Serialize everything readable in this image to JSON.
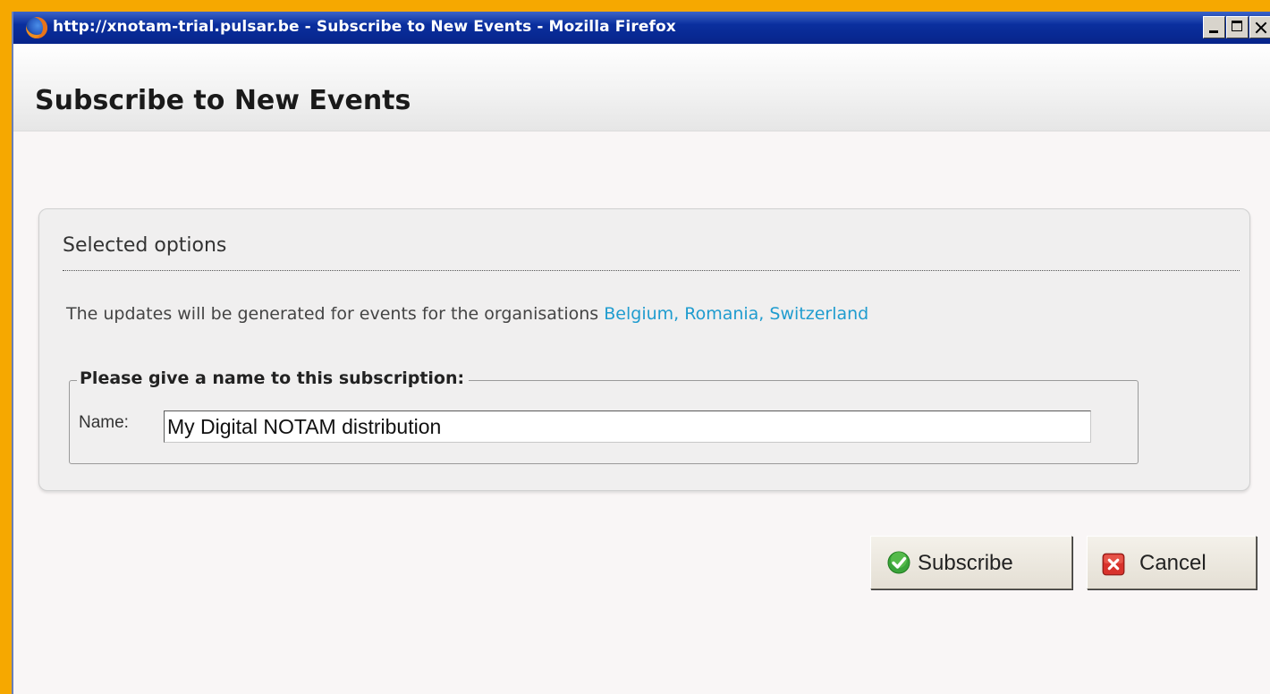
{
  "window": {
    "title": "http://xnotam-trial.pulsar.be - Subscribe to New Events - Mozilla Firefox"
  },
  "page": {
    "title": "Subscribe to New Events"
  },
  "panel": {
    "heading": "Selected options",
    "info_prefix": "The updates will be generated for events for the organisations ",
    "organisations": "Belgium, Romania, Switzerland"
  },
  "subscription": {
    "legend": "Please give a name to this subscription:",
    "name_label": "Name:",
    "name_value": "My Digital NOTAM distribution"
  },
  "actions": {
    "subscribe_label": "Subscribe",
    "cancel_label": "Cancel"
  },
  "icons": {
    "app": "firefox-icon",
    "subscribe": "green-check-icon",
    "cancel": "red-x-icon"
  },
  "colors": {
    "background": "#f6a800",
    "titlebar": "#0a2f9e",
    "link": "#1f9ccf"
  }
}
